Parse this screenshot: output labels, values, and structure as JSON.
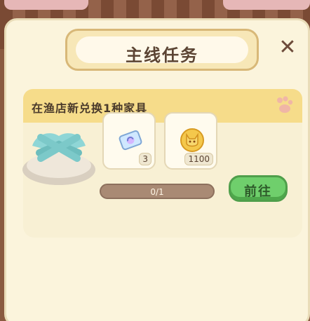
{
  "dialog": {
    "title": "主线任务",
    "close_symbol": "✕"
  },
  "task": {
    "title": "在渔店新兑换1种家具",
    "rewards": [
      {
        "icon": "ticket-icon",
        "count": "3"
      },
      {
        "icon": "coin-icon",
        "count": "1100"
      }
    ],
    "progress": {
      "text": "0/1",
      "fraction": 0
    },
    "go_button_label": "前往"
  },
  "colors": {
    "panel": "#fbf4dc",
    "header": "#f6dc8a",
    "button_green": "#6fcf6c",
    "progress_bg": "#a98a74"
  }
}
